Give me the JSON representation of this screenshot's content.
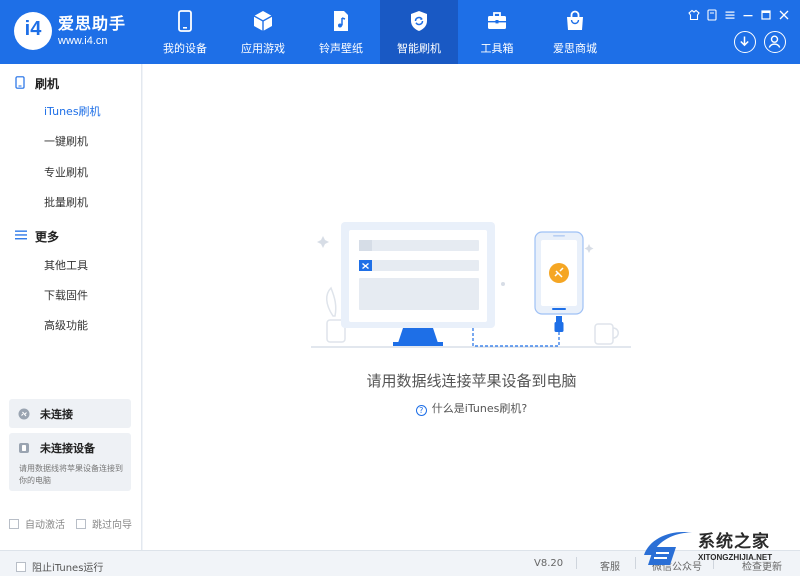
{
  "app": {
    "name": "爱思助手",
    "url": "www.i4.cn"
  },
  "nav": {
    "tabs": [
      {
        "label": "我的设备",
        "icon": "phone-icon"
      },
      {
        "label": "应用游戏",
        "icon": "cube-icon"
      },
      {
        "label": "铃声壁纸",
        "icon": "music-file-icon"
      },
      {
        "label": "智能刷机",
        "icon": "refresh-shield-icon",
        "active": true
      },
      {
        "label": "工具箱",
        "icon": "toolbox-icon"
      },
      {
        "label": "爱思商城",
        "icon": "shopping-bag-icon"
      }
    ]
  },
  "sidebar": {
    "flash_header": "刷机",
    "flash_items": [
      {
        "label": "iTunes刷机",
        "active": true
      },
      {
        "label": "一键刷机"
      },
      {
        "label": "专业刷机"
      },
      {
        "label": "批量刷机"
      }
    ],
    "more_header": "更多",
    "more_items": [
      {
        "label": "其他工具"
      },
      {
        "label": "下载固件"
      },
      {
        "label": "高级功能"
      }
    ],
    "status_disconnected": "未连接",
    "status_no_device_title": "未连接设备",
    "status_no_device_desc": "请用数据线将苹果设备连接到你的电脑",
    "opt_auto_activate": "自动激活",
    "opt_skip_wizard": "跳过向导"
  },
  "main": {
    "connect_message": "请用数据线连接苹果设备到电脑",
    "help_link": "什么是iTunes刷机?"
  },
  "footer": {
    "block_itunes": "阻止iTunes运行",
    "version": "V8.20",
    "support": "客服",
    "wechat": "微信公众号",
    "check_update": "检查更新"
  },
  "watermark": {
    "text": "系统之家",
    "url": "XITONGZHIJIA.NET"
  },
  "colors": {
    "brand": "#1e6fe7",
    "brand_dark": "#1959c4",
    "accent": "#f5a623"
  }
}
